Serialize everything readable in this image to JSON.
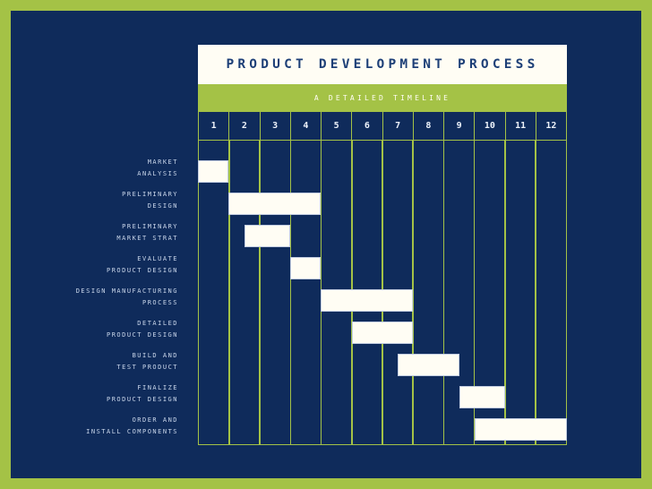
{
  "theme": {
    "border_green": "#a4c246",
    "background_navy": "#0f2b5b",
    "bar_cream": "#fffdf4",
    "title_blue": "#1d3f77",
    "label_light": "#c9d6ea"
  },
  "header": {
    "title": "PRODUCT DEVELOPMENT PROCESS",
    "subtitle": "A DETAILED TIMELINE"
  },
  "chart_data": {
    "type": "bar",
    "title": "PRODUCT DEVELOPMENT PROCESS",
    "subtitle": "A DETAILED TIMELINE",
    "xlabel": "",
    "ylabel": "",
    "orientation": "horizontal",
    "chart_kind": "gantt",
    "grid": true,
    "legend": "none",
    "xlim": [
      1,
      13
    ],
    "categories": [
      "1",
      "2",
      "3",
      "4",
      "5",
      "6",
      "7",
      "8",
      "9",
      "10",
      "11",
      "12"
    ],
    "tasks": [
      {
        "label_lines": [
          "MARKET",
          "ANALYSIS"
        ],
        "name": "MARKET ANALYSIS",
        "start": 1.0,
        "end": 2.0,
        "duration": 1.0
      },
      {
        "label_lines": [
          "PRELIMINARY",
          "DESIGN"
        ],
        "name": "PRELIMINARY DESIGN",
        "start": 2.0,
        "end": 5.0,
        "duration": 3.0
      },
      {
        "label_lines": [
          "PRELIMINARY",
          "MARKET STRAT"
        ],
        "name": "PRELIMINARY MARKET STRAT",
        "start": 2.5,
        "end": 4.0,
        "duration": 1.5
      },
      {
        "label_lines": [
          "EVALUATE",
          "PRODUCT DESIGN"
        ],
        "name": "EVALUATE PRODUCT DESIGN",
        "start": 4.0,
        "end": 5.0,
        "duration": 1.0
      },
      {
        "label_lines": [
          "DESIGN MANUFACTURING",
          "PROCESS"
        ],
        "name": "DESIGN MANUFACTURING PROCESS",
        "start": 5.0,
        "end": 8.0,
        "duration": 3.0
      },
      {
        "label_lines": [
          "DETAILED",
          "PRODUCT DESIGN"
        ],
        "name": "DETAILED PRODUCT DESIGN",
        "start": 6.0,
        "end": 8.0,
        "duration": 2.0
      },
      {
        "label_lines": [
          "BUILD AND",
          "TEST PRODUCT"
        ],
        "name": "BUILD AND TEST PRODUCT",
        "start": 7.5,
        "end": 9.5,
        "duration": 2.0
      },
      {
        "label_lines": [
          "FINALIZE",
          "PRODUCT DESIGN"
        ],
        "name": "FINALIZE PRODUCT DESIGN",
        "start": 9.5,
        "end": 11.0,
        "duration": 1.5
      },
      {
        "label_lines": [
          "ORDER AND",
          "INSTALL COMPONENTS"
        ],
        "name": "ORDER AND INSTALL COMPONENTS",
        "start": 10.0,
        "end": 13.0,
        "duration": 3.0
      }
    ]
  }
}
